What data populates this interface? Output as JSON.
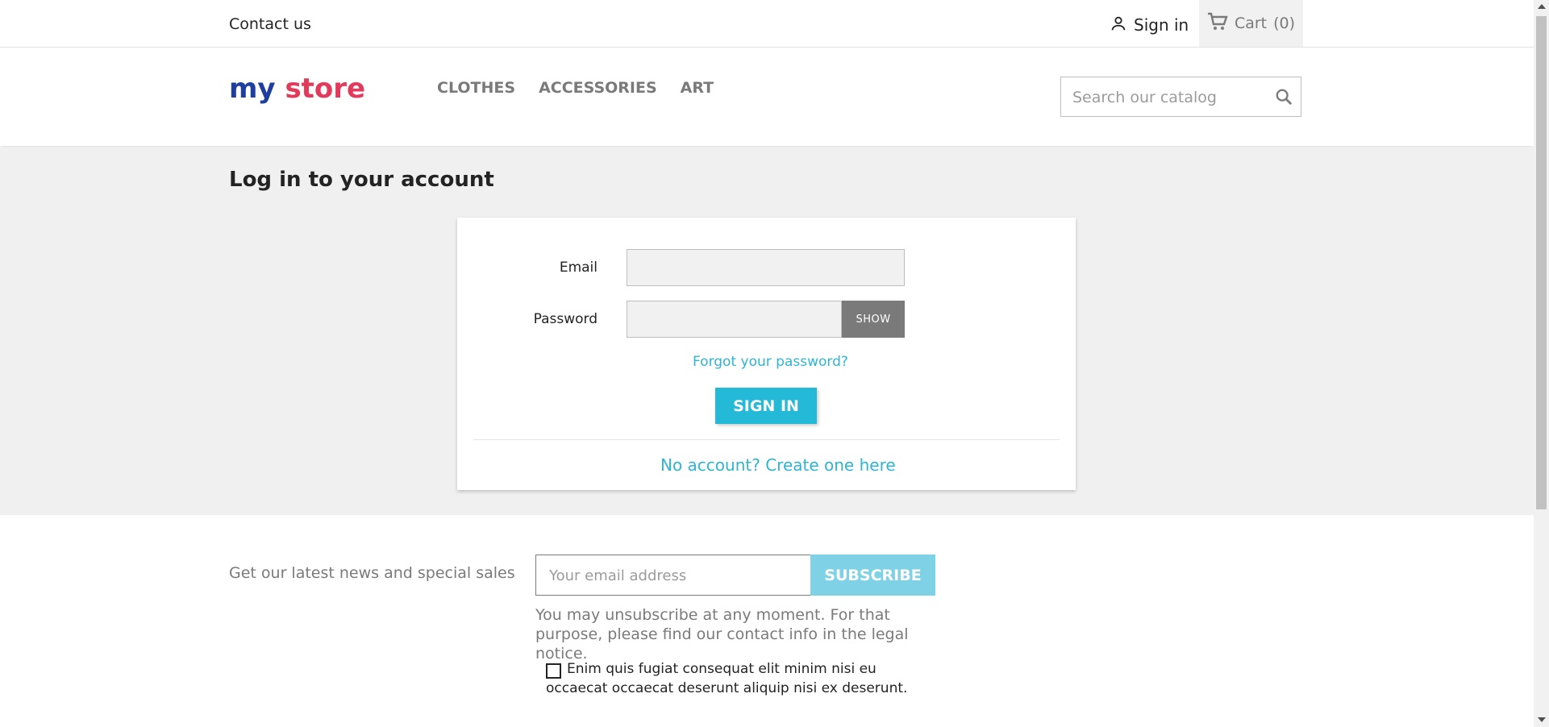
{
  "topbar": {
    "contact_label": "Contact us",
    "signin_label": "Sign in",
    "cart_label": "Cart",
    "cart_count": "(0)"
  },
  "header": {
    "logo": {
      "text_part1": "my",
      "text_part2": "store",
      "colors": [
        "#1e3fa0",
        "#e8a81d",
        "#e33a5c",
        "#2fb5d2"
      ]
    },
    "nav": [
      "CLOTHES",
      "ACCESSORIES",
      "ART"
    ],
    "search": {
      "placeholder": "Search our catalog",
      "value": ""
    }
  },
  "main": {
    "title": "Log in to your account",
    "form": {
      "email_label": "Email",
      "email_value": "",
      "password_label": "Password",
      "password_value": "",
      "show_label": "SHOW",
      "forgot_label": "Forgot your password?",
      "submit_label": "SIGN IN",
      "create_label": "No account? Create one here"
    }
  },
  "footer": {
    "newsletter_text": "Get our latest news and special sales",
    "email_placeholder": "Your email address",
    "subscribe_label": "SUBSCRIBE",
    "unsubscribe_text": "You may unsubscribe at any moment. For that purpose, please find our contact info in the legal notice.",
    "consent_text": "Enim quis fugiat consequat elit minim nisi eu occaecat occaecat deserunt aliquip nisi ex deserunt.",
    "consent_checked": false
  },
  "colors": {
    "accent": "#24b9d7",
    "link": "#2fb5d2",
    "background": "#f0f0f0"
  }
}
